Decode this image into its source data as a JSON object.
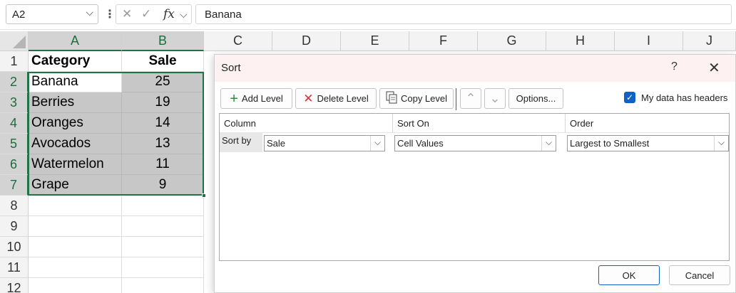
{
  "formula_bar": {
    "name_box": "A2",
    "name_box_dropdown": "⌵",
    "more_icon": "⋮",
    "cancel_icon": "✕",
    "enter_icon": "✓",
    "fx": "fx",
    "fx_dropdown": "⌵",
    "formula": "Banana"
  },
  "columns": [
    "A",
    "B",
    "C",
    "D",
    "E",
    "F",
    "G",
    "H",
    "I",
    "J"
  ],
  "rows": [
    "1",
    "2",
    "3",
    "4",
    "5",
    "6",
    "7",
    "8",
    "9",
    "10",
    "11",
    "12"
  ],
  "sheet": {
    "header": {
      "category": "Category",
      "sale": "Sale"
    },
    "data": [
      {
        "category": "Banana",
        "sale": "25"
      },
      {
        "category": "Berries",
        "sale": "19"
      },
      {
        "category": "Oranges",
        "sale": "14"
      },
      {
        "category": "Avocados",
        "sale": "13"
      },
      {
        "category": "Watermelon",
        "sale": "11"
      },
      {
        "category": "Grape",
        "sale": "9"
      }
    ]
  },
  "dialog": {
    "title": "Sort",
    "help": "?",
    "close": "✕",
    "toolbar": {
      "add_level": "Add Level",
      "delete_level": "Delete Level",
      "copy_level": "Copy Level",
      "move_up": "⌃",
      "move_down": "⌄",
      "options": "Options...",
      "headers_label": "My data has headers",
      "headers_checked": true,
      "check_mark": "✓"
    },
    "columns": {
      "column": "Column",
      "sort_on": "Sort On",
      "order": "Order"
    },
    "level": {
      "label": "Sort by",
      "column": "Sale",
      "sort_on": "Cell Values",
      "order": "Largest to Smallest",
      "arrow": "⌵"
    },
    "ok": "OK",
    "cancel": "Cancel"
  },
  "colors": {
    "accent_green": "#217346",
    "dialog_blue": "#0f62c4",
    "delete_red": "#d13438",
    "add_green": "#2e8b3a"
  }
}
